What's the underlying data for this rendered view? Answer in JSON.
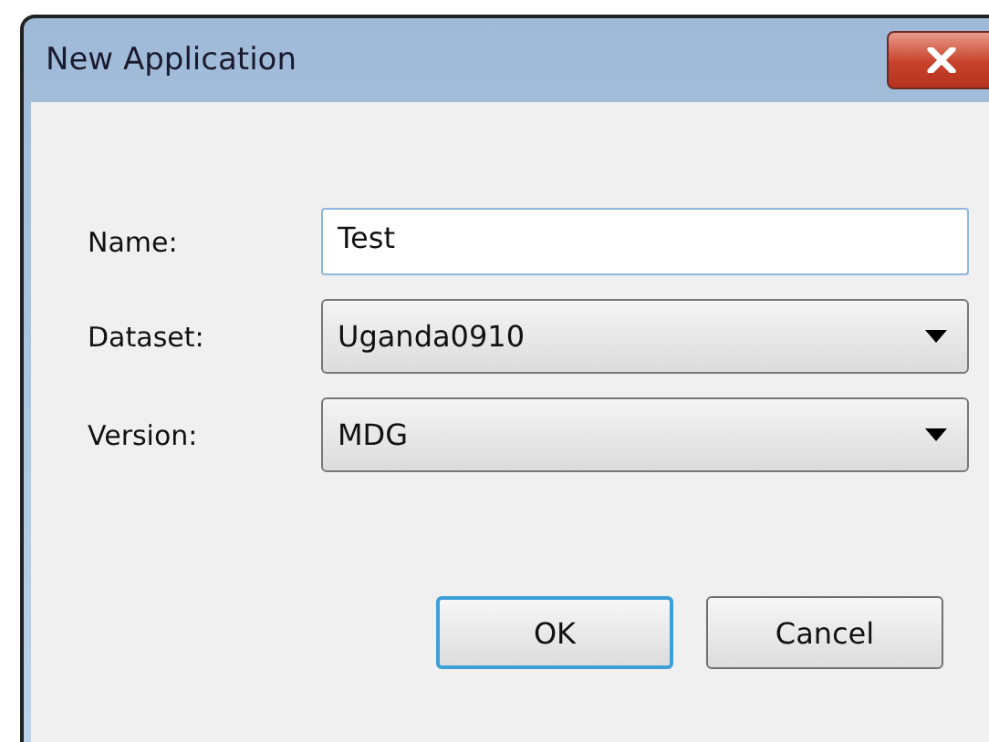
{
  "window": {
    "title": "New Application"
  },
  "fields": [
    {
      "label": "Name:",
      "kind": "text",
      "value": "Test"
    },
    {
      "label": "Dataset:",
      "kind": "dropdown",
      "value": "Uganda0910"
    },
    {
      "label": "Version:",
      "kind": "dropdown",
      "value": "MDG"
    }
  ],
  "buttons": [
    {
      "label": "OK",
      "default": true
    },
    {
      "label": "Cancel",
      "default": false
    }
  ]
}
